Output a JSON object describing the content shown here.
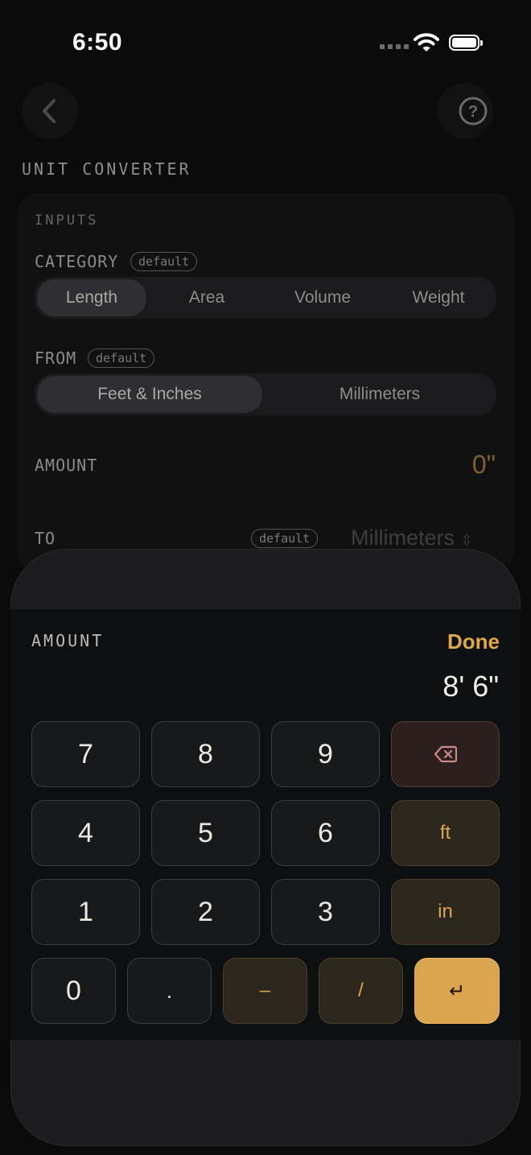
{
  "status_bar": {
    "time": "6:50"
  },
  "header": {
    "title": "UNIT CONVERTER"
  },
  "inputs": {
    "section_label": "INPUTS",
    "category": {
      "label": "CATEGORY",
      "badge": "default",
      "options": [
        "Length",
        "Area",
        "Volume",
        "Weight"
      ],
      "selected": "Length"
    },
    "from": {
      "label": "FROM",
      "badge": "default",
      "options": [
        "Feet & Inches",
        "Millimeters"
      ],
      "selected": "Feet & Inches"
    },
    "amount": {
      "label": "AMOUNT",
      "value": "0\""
    },
    "to": {
      "label": "TO",
      "badge": "default",
      "value": "Millimeters"
    }
  },
  "keypad": {
    "title": "AMOUNT",
    "done_label": "Done",
    "display": "8' 6\"",
    "keys": {
      "k7": "7",
      "k8": "8",
      "k9": "9",
      "k4": "4",
      "k5": "5",
      "k6": "6",
      "k1": "1",
      "k2": "2",
      "k3": "3",
      "k0": "0",
      "dot": ".",
      "dash": "–",
      "slash": "/",
      "ft": "ft",
      "in": "in",
      "enter": "↵"
    },
    "icons": {
      "delete": "delete-backspace-icon"
    },
    "colors": {
      "accent": "#e0a84a",
      "delete_tint": "#c98a86"
    }
  }
}
